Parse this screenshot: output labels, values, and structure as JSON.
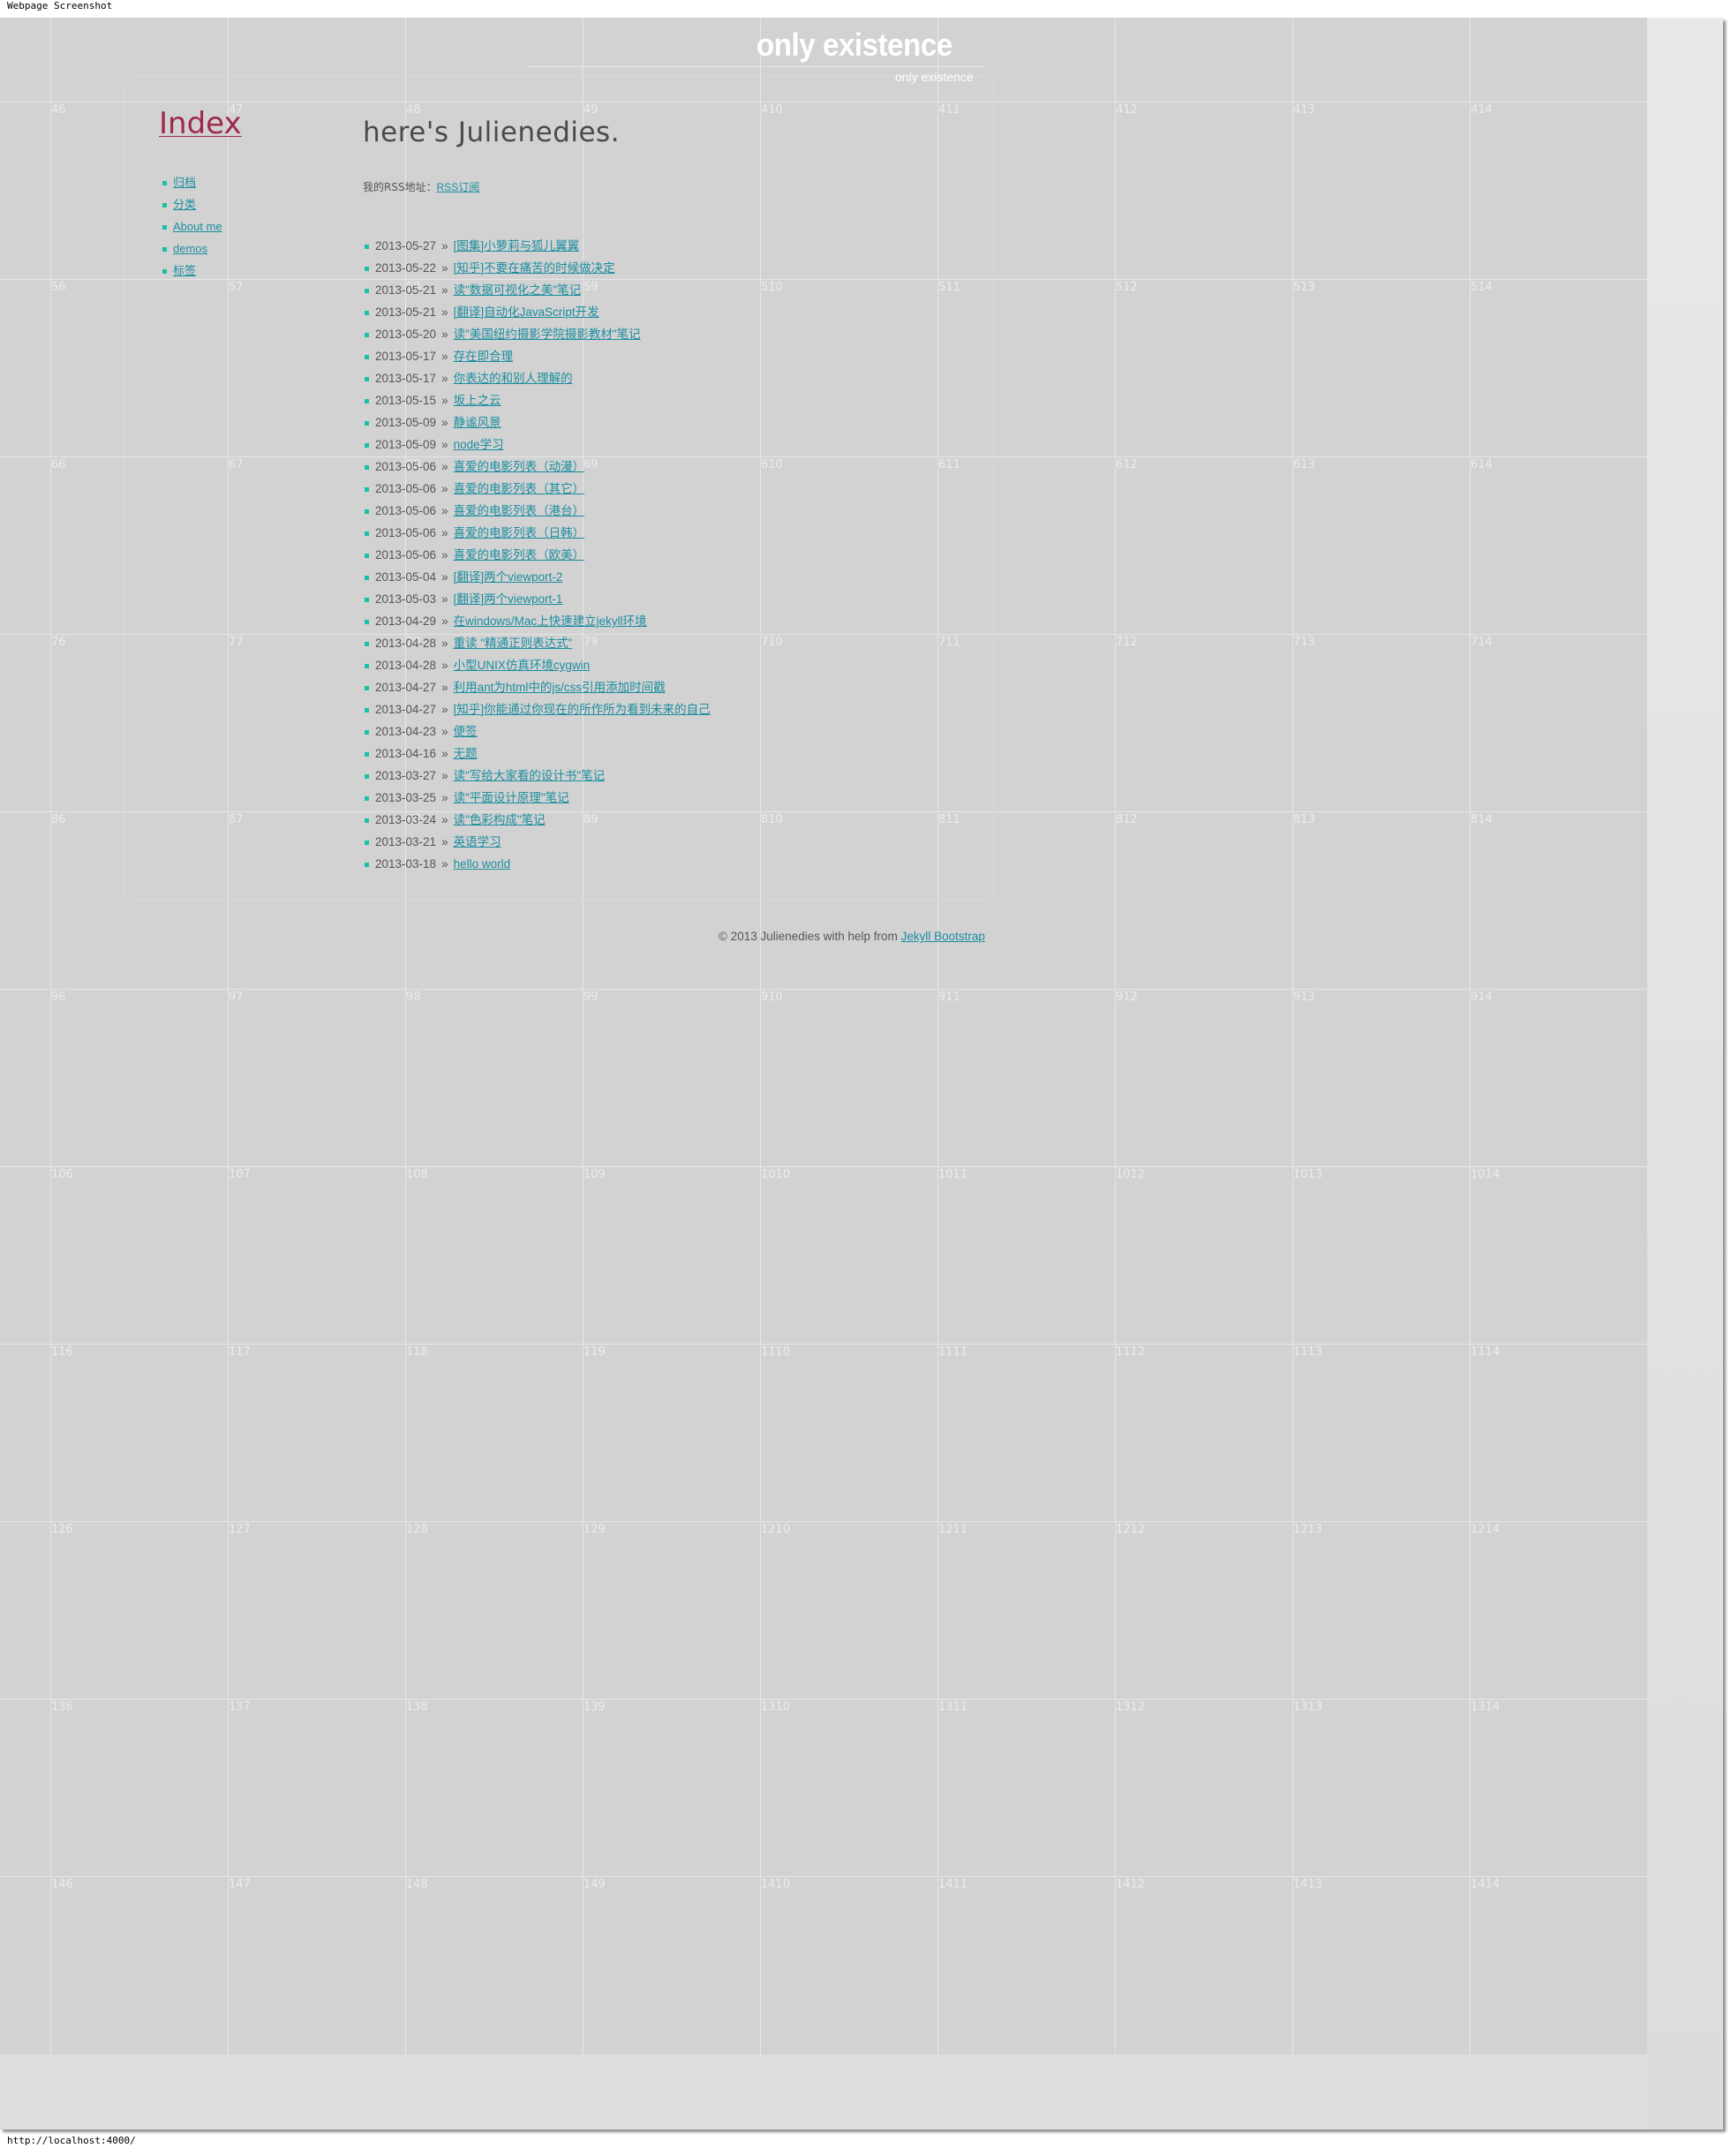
{
  "frame": {
    "title": "Webpage Screenshot",
    "status_url": "http://localhost:4000/"
  },
  "header": {
    "title": "only existence",
    "subtitle": "only existence"
  },
  "sidebar": {
    "title": "Index",
    "items": [
      {
        "label": "归档"
      },
      {
        "label": "分类"
      },
      {
        "label": "About me"
      },
      {
        "label": "demos"
      },
      {
        "label": "标签"
      }
    ]
  },
  "main": {
    "heading": "here's Julienedies.",
    "rss_label": "我的RSS地址：",
    "rss_link": "RSS订阅",
    "posts": [
      {
        "date": "2013-05-27",
        "title": "[图集]小萝莉与狐儿翼翼"
      },
      {
        "date": "2013-05-22",
        "title": "[知乎]不要在痛苦的时候做决定"
      },
      {
        "date": "2013-05-21",
        "title": "读\"数据可视化之美\"笔记"
      },
      {
        "date": "2013-05-21",
        "title": "[翻译]自动化JavaScript开发"
      },
      {
        "date": "2013-05-20",
        "title": "读\"美国纽约摄影学院摄影教材\"笔记"
      },
      {
        "date": "2013-05-17",
        "title": "存在即合理"
      },
      {
        "date": "2013-05-17",
        "title": "你表达的和别人理解的"
      },
      {
        "date": "2013-05-15",
        "title": "坂上之云"
      },
      {
        "date": "2013-05-09",
        "title": "静谧风景"
      },
      {
        "date": "2013-05-09",
        "title": "node学习"
      },
      {
        "date": "2013-05-06",
        "title": "喜爱的电影列表（动漫）"
      },
      {
        "date": "2013-05-06",
        "title": "喜爱的电影列表（其它）"
      },
      {
        "date": "2013-05-06",
        "title": "喜爱的电影列表（港台）"
      },
      {
        "date": "2013-05-06",
        "title": "喜爱的电影列表（日韩）"
      },
      {
        "date": "2013-05-06",
        "title": "喜爱的电影列表（欧美）"
      },
      {
        "date": "2013-05-04",
        "title": "[翻译]两个viewport-2"
      },
      {
        "date": "2013-05-03",
        "title": "[翻译]两个viewport-1"
      },
      {
        "date": "2013-04-29",
        "title": "在windows/Mac上快速建立jekyll环境"
      },
      {
        "date": "2013-04-28",
        "title": "重读 \"精通正则表达式\""
      },
      {
        "date": "2013-04-28",
        "title": "小型UNIX仿真环境cygwin"
      },
      {
        "date": "2013-04-27",
        "title": "利用ant为html中的js/css引用添加时间戳"
      },
      {
        "date": "2013-04-27",
        "title": "[知乎]你能通过你现在的所作所为看到未来的自己"
      },
      {
        "date": "2013-04-23",
        "title": "便签"
      },
      {
        "date": "2013-04-16",
        "title": "无题"
      },
      {
        "date": "2013-03-27",
        "title": "读\"写给大家看的设计书\"笔记"
      },
      {
        "date": "2013-03-25",
        "title": "读\"平面设计原理\"笔记"
      },
      {
        "date": "2013-03-24",
        "title": "读\"色彩构成\"笔记"
      },
      {
        "date": "2013-03-21",
        "title": "英语学习"
      },
      {
        "date": "2013-03-18",
        "title": "hello world"
      }
    ],
    "separator": "»"
  },
  "footer": {
    "text": "© 2013 Julienedies with help from ",
    "link": "Jekyll Bootstrap"
  },
  "grid_overlay": {
    "row_labels": [
      [
        "46",
        "47",
        "48",
        "49",
        "410",
        "411",
        "412",
        "413",
        "414"
      ],
      [
        "56",
        "57",
        "58",
        "59",
        "510",
        "511",
        "512",
        "513",
        "514"
      ],
      [
        "66",
        "67",
        "68",
        "69",
        "610",
        "611",
        "612",
        "613",
        "614"
      ],
      [
        "76",
        "77",
        "78",
        "79",
        "710",
        "711",
        "712",
        "713",
        "714"
      ],
      [
        "86",
        "87",
        "88",
        "89",
        "810",
        "811",
        "812",
        "813",
        "814"
      ],
      [
        "96",
        "97",
        "98",
        "99",
        "910",
        "911",
        "912",
        "913",
        "914"
      ],
      [
        "106",
        "107",
        "108",
        "109",
        "1010",
        "1011",
        "1012",
        "1013",
        "1014"
      ],
      [
        "116",
        "117",
        "118",
        "119",
        "1110",
        "1111",
        "1112",
        "1113",
        "1114"
      ],
      [
        "126",
        "127",
        "128",
        "129",
        "1210",
        "1211",
        "1212",
        "1213",
        "1214"
      ],
      [
        "136",
        "137",
        "138",
        "139",
        "1310",
        "1311",
        "1312",
        "1313",
        "1314"
      ],
      [
        "146",
        "147",
        "148",
        "149",
        "1410",
        "1411",
        "1412",
        "1413",
        "1414"
      ]
    ]
  },
  "colors": {
    "accent": "#a0294b",
    "link": "#1b8ea0",
    "bullet": "#17c1a5",
    "background": "#d2d2d2"
  }
}
